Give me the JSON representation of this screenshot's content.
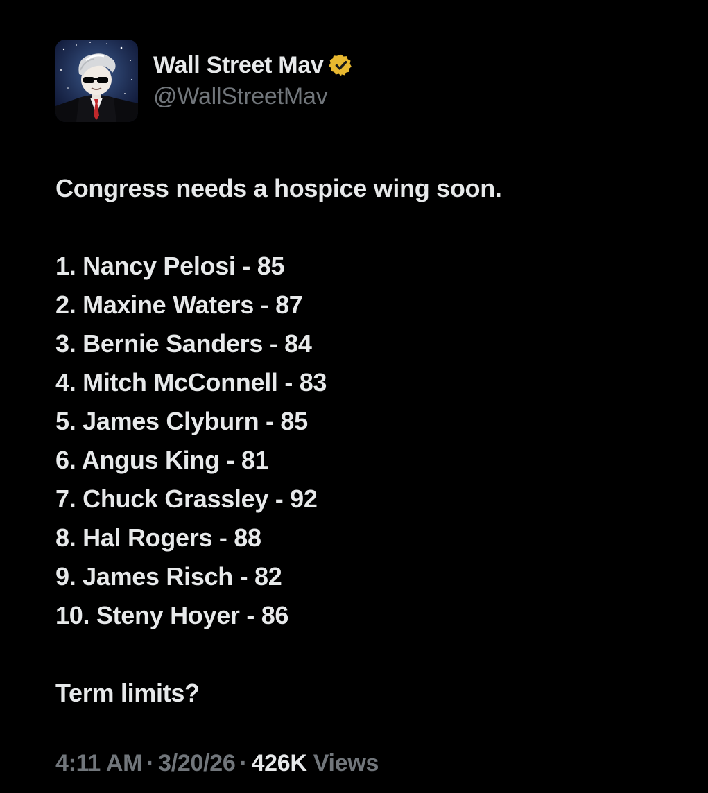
{
  "author": {
    "display_name": "Wall Street Mav",
    "handle": "@WallStreetMav",
    "verified_icon": "verified-badge-gold",
    "badge_color": "#e8b830"
  },
  "tweet": {
    "intro": "Congress needs a hospice wing soon.",
    "list": [
      "1. Nancy Pelosi - 85",
      "2. Maxine Waters - 87",
      "3. Bernie Sanders - 84",
      "4. Mitch McConnell - 83",
      "5. James Clyburn - 85",
      "6. Angus King - 81",
      "7. Chuck Grassley - 92",
      "8. Hal Rogers - 88",
      "9. James Risch - 82",
      "10. Steny Hoyer - 86"
    ],
    "outro": "Term limits?"
  },
  "meta": {
    "time": "4:11 AM",
    "separator": "·",
    "date": "3/20/26",
    "views_count": "426K",
    "views_label": "Views"
  },
  "colors": {
    "background": "#000000",
    "text_primary": "#e7e9ea",
    "text_secondary": "#71767b"
  }
}
